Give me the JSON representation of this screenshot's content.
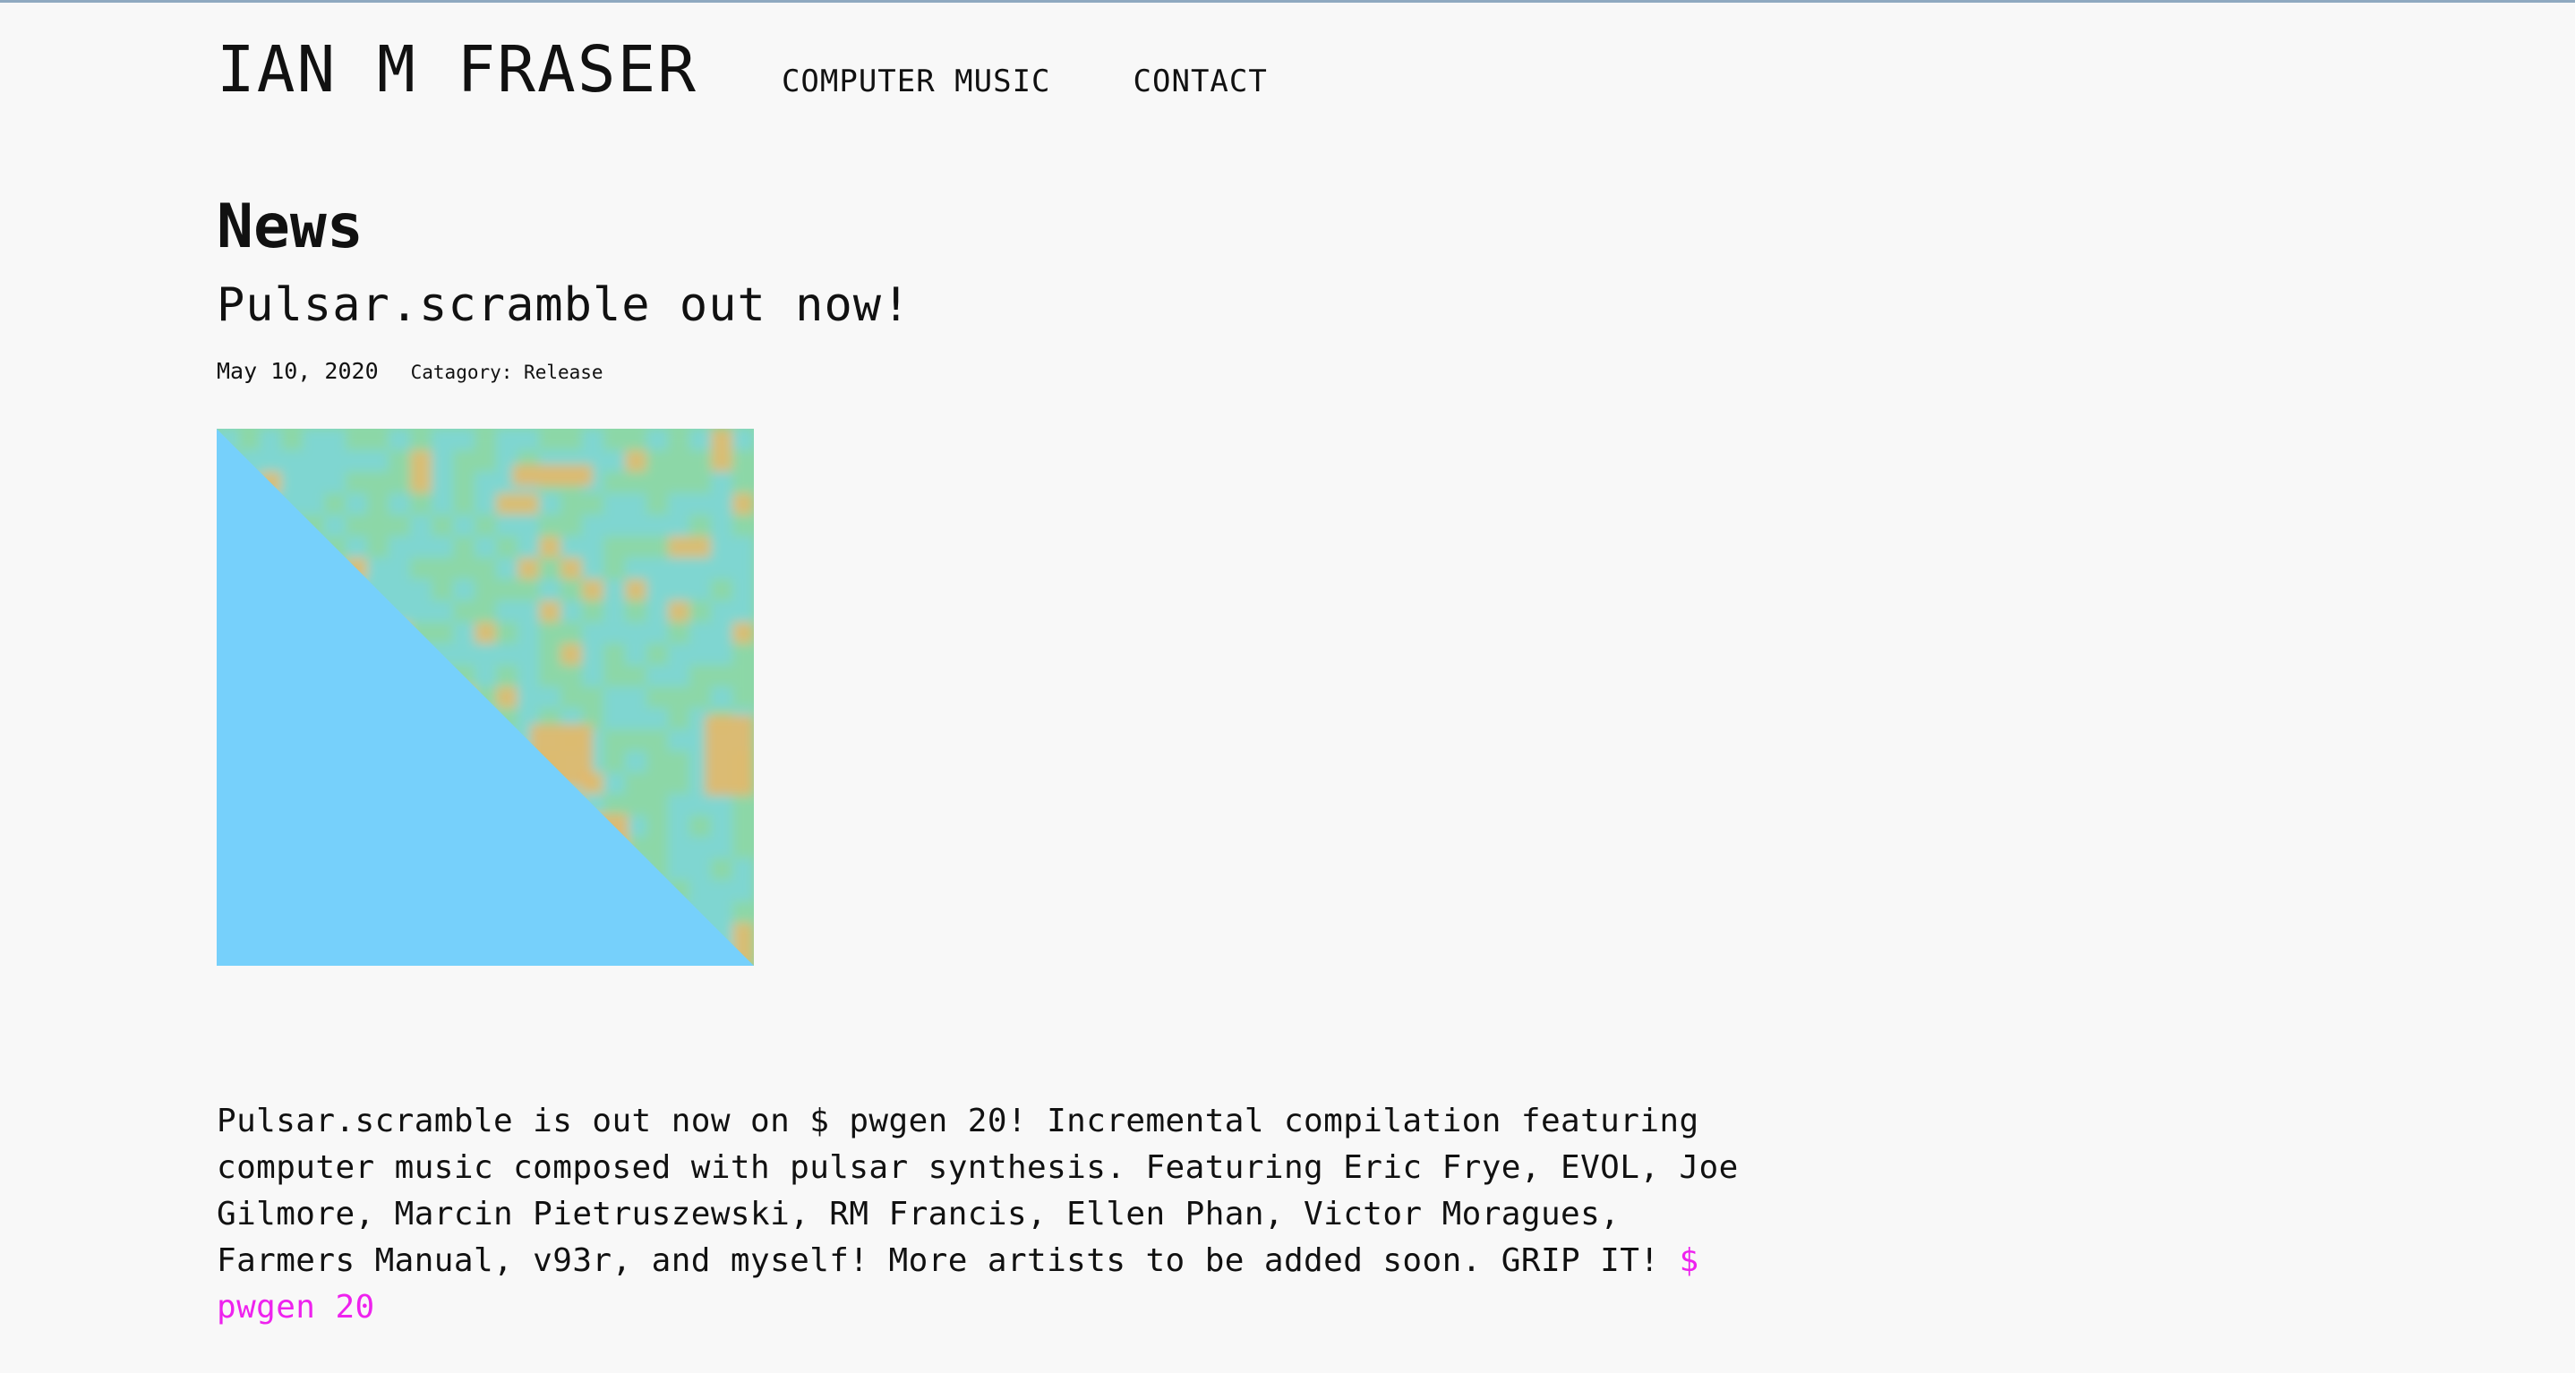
{
  "site": {
    "title": "IAN M FRASER",
    "nav": [
      {
        "label": "COMPUTER MUSIC"
      },
      {
        "label": "CONTACT"
      }
    ]
  },
  "page": {
    "title": "News"
  },
  "post": {
    "title": "Pulsar.scramble out now!",
    "date": "May 10, 2020",
    "category": "Catagory: Release",
    "body_text": "Pulsar.scramble is out now on $ pwgen 20! Incremental compilation featuring computer music composed with pulsar synthesis. Featuring Eric Frye, EVOL, Joe Gilmore, Marcin Pietruszewski, RM Francis, Ellen Phan, Victor Moragues, Farmers Manual, v93r, and myself! More artists to be added soon. GRIP IT! ",
    "link_label": "$ pwgen 20"
  },
  "colors": {
    "background": "#f8f8f8",
    "text": "#111111",
    "link": "#ee22ee",
    "art_sky_blue": "#76d0fb",
    "art_green": "#8cd7a7",
    "art_cyan": "#7dd6d8",
    "art_orange": "#e6b86a"
  },
  "icons": {
    "cover_art": "pulsar-scramble-cover-art"
  }
}
